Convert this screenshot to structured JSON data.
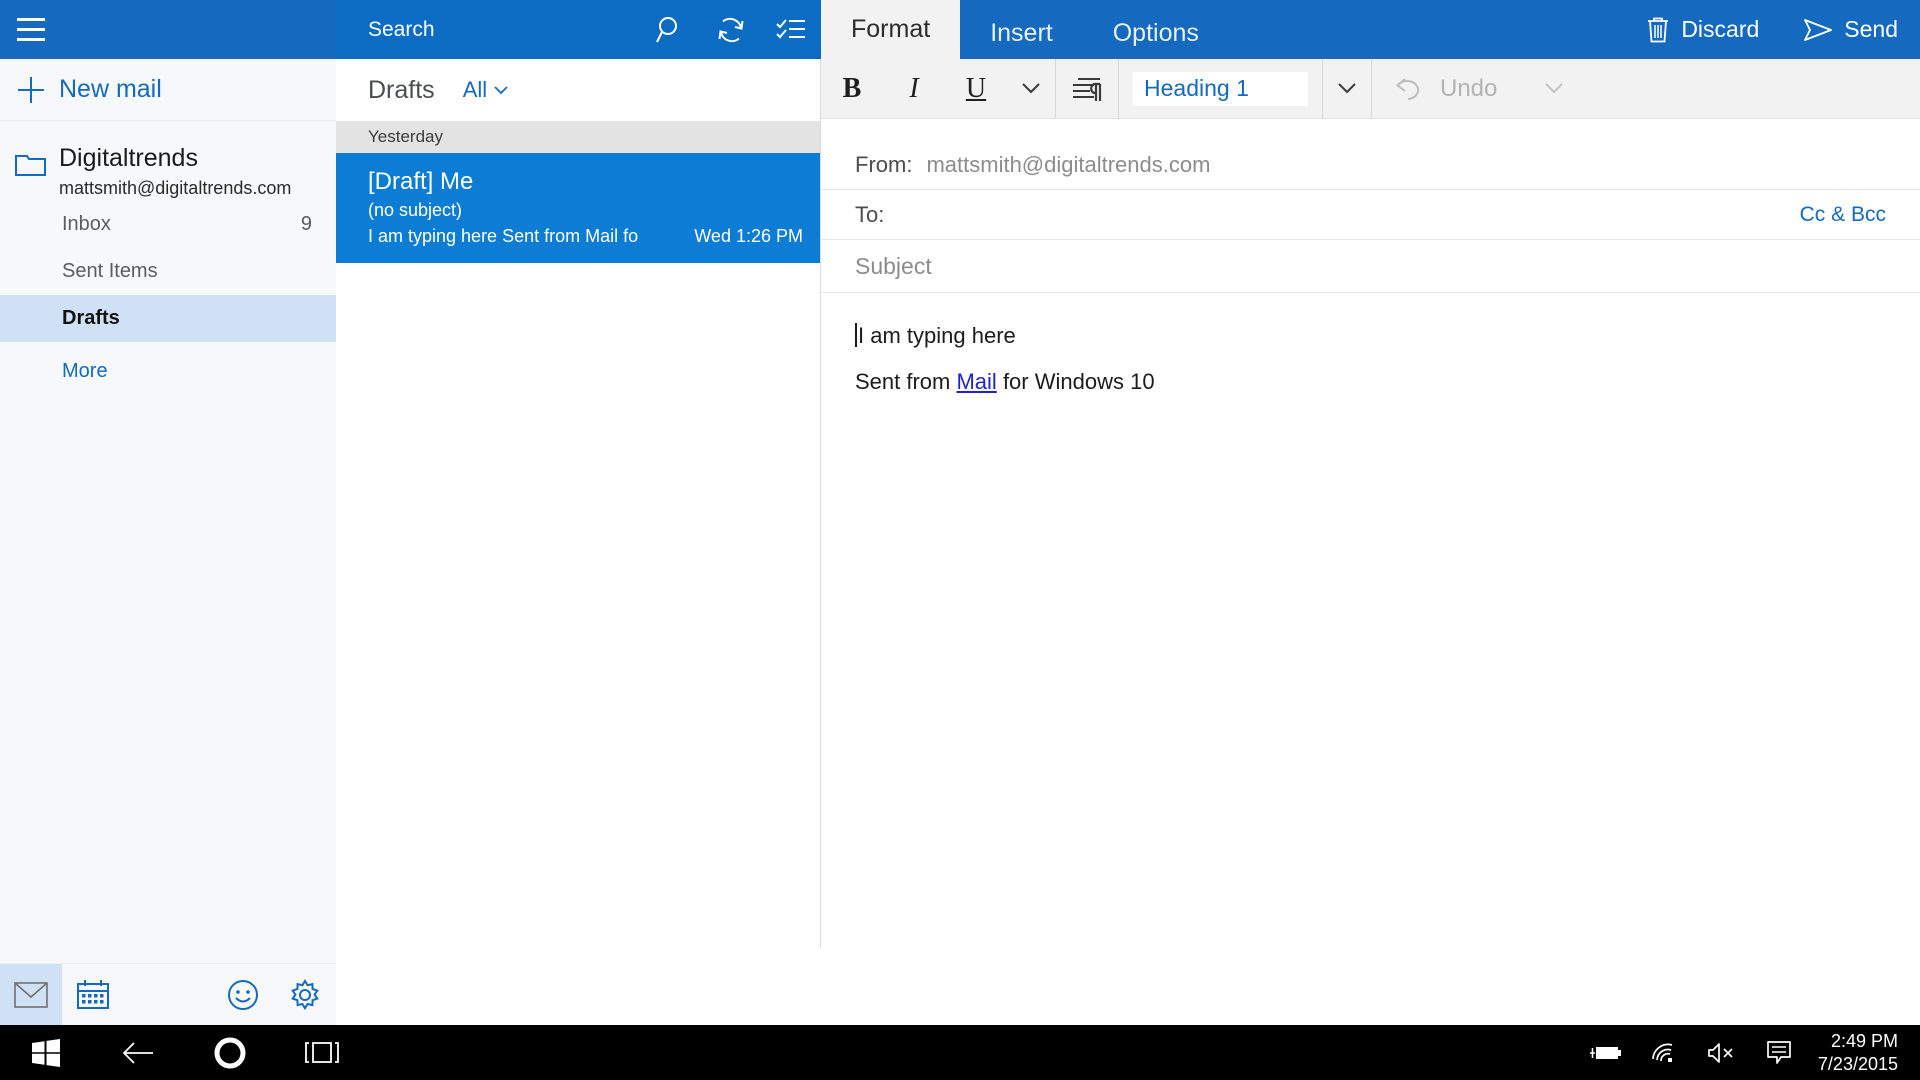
{
  "sidebar": {
    "menu_icon": "hamburger-icon",
    "new_mail_label": "New mail",
    "account": {
      "name": "Digitaltrends",
      "email": "mattsmith@digitaltrends.com",
      "icon": "folder-icon"
    },
    "folders": [
      {
        "label": "Inbox",
        "count": "9",
        "selected": false
      },
      {
        "label": "Sent Items",
        "count": "",
        "selected": false
      },
      {
        "label": "Drafts",
        "count": "",
        "selected": true
      }
    ],
    "more_label": "More",
    "footer_icons": [
      {
        "name": "mail-icon",
        "active": true
      },
      {
        "name": "calendar-icon",
        "active": false
      },
      {
        "name": "feedback-smiley-icon",
        "active": false
      },
      {
        "name": "settings-gear-icon",
        "active": false
      }
    ]
  },
  "message_list": {
    "search_placeholder": "Search",
    "search_icon": "search-icon",
    "sync_icon": "sync-icon",
    "select_icon": "select-mode-icon",
    "title": "Drafts",
    "filter_label": "All",
    "filter_chevron": "chevron-down-icon",
    "group_label": "Yesterday",
    "messages": [
      {
        "from": "[Draft] Me",
        "subject": "(no subject)",
        "preview": "I am typing here Sent from Mail fo",
        "time": "Wed 1:26 PM",
        "selected": true
      }
    ]
  },
  "compose": {
    "tabs": [
      {
        "label": "Format",
        "active": true
      },
      {
        "label": "Insert",
        "active": false
      },
      {
        "label": "Options",
        "active": false
      }
    ],
    "discard_label": "Discard",
    "discard_icon": "trash-icon",
    "send_label": "Send",
    "send_icon": "send-arrow-icon",
    "toolbar": {
      "bold": "B",
      "italic": "I",
      "underline": "U",
      "font_more_icon": "chevron-down-icon",
      "paragraph_icon": "paragraph-mark-icon",
      "style_value": "Heading 1",
      "style_more_icon": "chevron-down-icon",
      "undo_label": "Undo",
      "undo_icon": "undo-arrow-icon",
      "undo_chevron": "chevron-down-icon",
      "undo_disabled": true
    },
    "from_label": "From:",
    "from_value": "mattsmith@digitaltrends.com",
    "to_label": "To:",
    "to_value": "",
    "cc_bcc_label": "Cc & Bcc",
    "subject_placeholder": "Subject",
    "body_line_1": "I am typing here",
    "body_sig_pre": "Sent from ",
    "body_sig_link": "Mail",
    "body_sig_post": " for Windows 10"
  },
  "taskbar": {
    "start_icon": "windows-start-icon",
    "back_icon": "back-arrow-icon",
    "cortana_icon": "cortana-circle-icon",
    "taskview_icon": "task-view-icon",
    "tray": [
      {
        "name": "battery-charging-icon"
      },
      {
        "name": "wifi-icon"
      },
      {
        "name": "speaker-muted-icon"
      },
      {
        "name": "action-center-icon"
      }
    ],
    "time": "2:49 PM",
    "date": "7/23/2015"
  },
  "colors": {
    "accent_blue": "#1569bf",
    "search_blue": "#0c6cc4",
    "selection_blue": "#0c7cd5",
    "folder_highlight": "#cfe1f5",
    "link_blue": "#1569bf",
    "taskbar_black": "#000000"
  }
}
